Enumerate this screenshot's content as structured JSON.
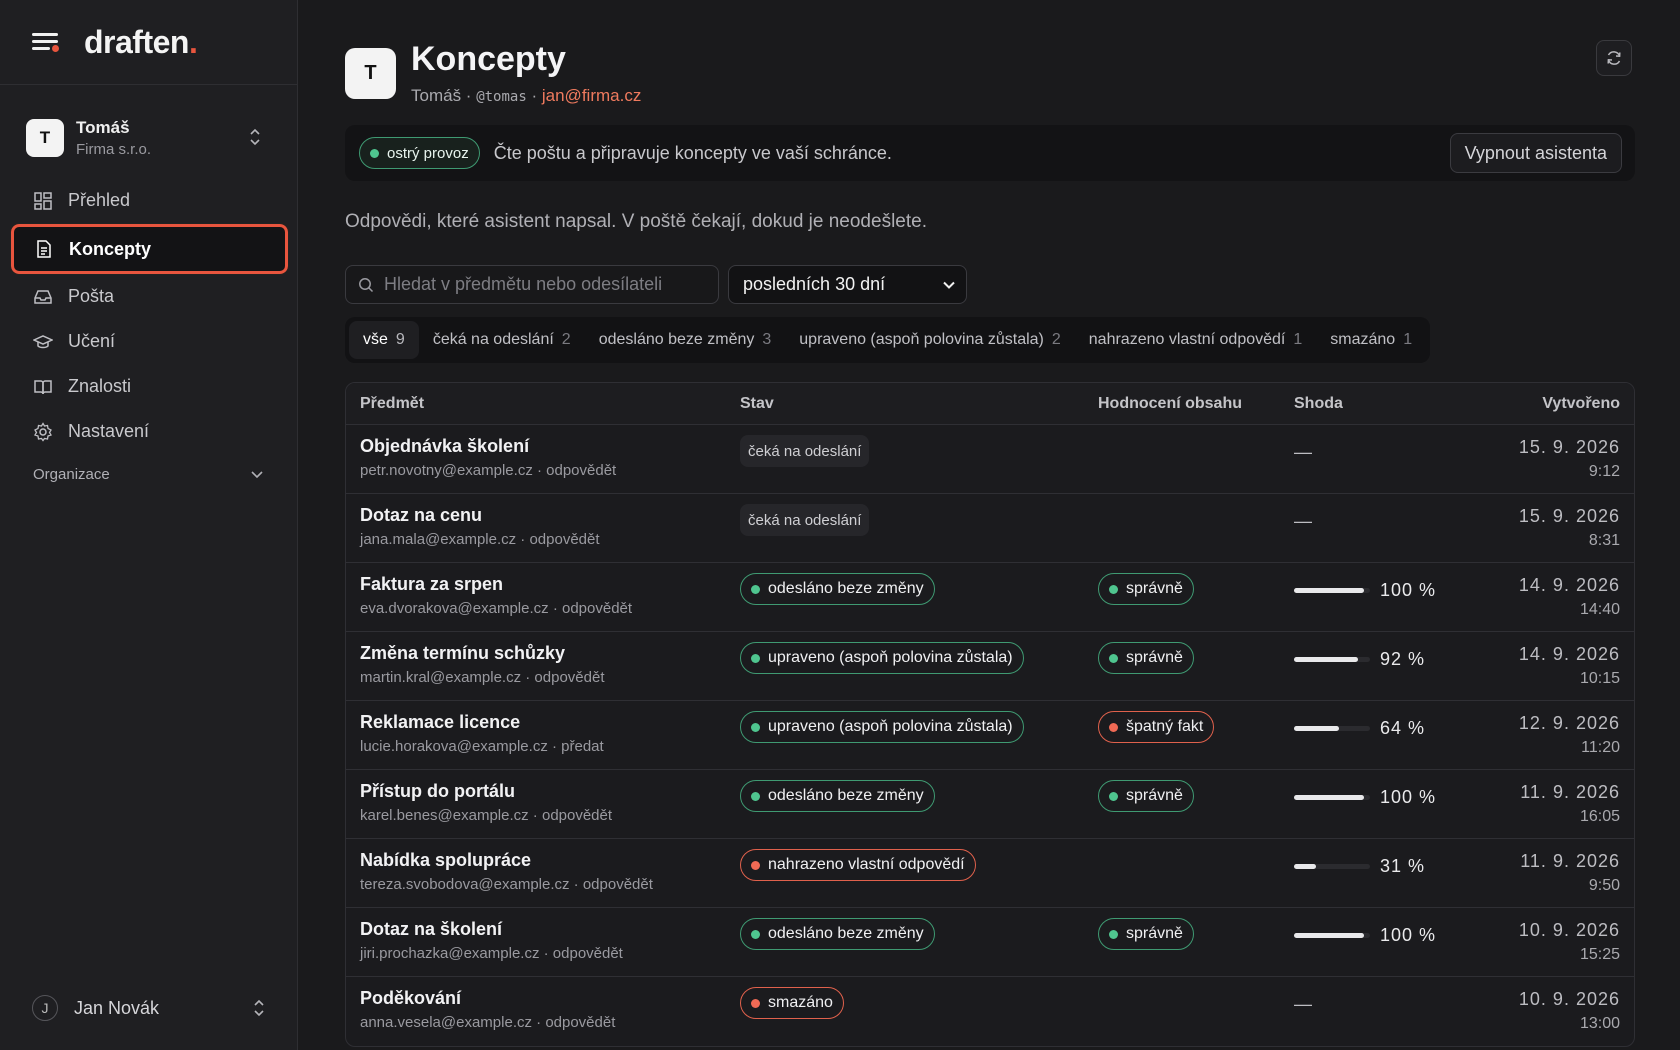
{
  "brand": {
    "name": "draften",
    "dot": "."
  },
  "account": {
    "initial": "T",
    "name": "Tomáš",
    "org": "Firma s.r.o."
  },
  "nav": [
    {
      "label": "Přehled",
      "icon": "dashboard-icon"
    },
    {
      "label": "Koncepty",
      "icon": "document-icon",
      "active": true
    },
    {
      "label": "Pošta",
      "icon": "inbox-icon"
    },
    {
      "label": "Učení",
      "icon": "graduation-cap-icon"
    },
    {
      "label": "Znalosti",
      "icon": "book-icon"
    },
    {
      "label": "Nastavení",
      "icon": "gear-icon"
    }
  ],
  "org_section": "Organizace",
  "user": {
    "initial": "J",
    "name": "Jan Novák"
  },
  "header": {
    "initial": "T",
    "title": "Koncepty",
    "sub_name": "Tomáš",
    "sub_sep": " · ",
    "handle": "@tomas",
    "email": "jan@firma.cz"
  },
  "status": {
    "pill": "ostrý provoz",
    "text": "Čte poštu a připravuje koncepty ve vaší schránce.",
    "button": "Vypnout asistenta"
  },
  "lead": "Odpovědi, které asistent napsal. V poště čekají, dokud je neodešlete.",
  "search": {
    "placeholder": "Hledat v předmětu nebo odesílateli",
    "value": ""
  },
  "period": {
    "selected": "posledních 30 dní"
  },
  "filters": [
    {
      "label": "vše",
      "count": "9",
      "active": true
    },
    {
      "label": "čeká na odeslání",
      "count": "2"
    },
    {
      "label": "odesláno beze změny",
      "count": "3"
    },
    {
      "label": "upraveno (aspoň polovina zůstala)",
      "count": "2"
    },
    {
      "label": "nahrazeno vlastní odpovědí",
      "count": "1"
    },
    {
      "label": "smazáno",
      "count": "1"
    }
  ],
  "table": {
    "headers": {
      "subject": "Předmět",
      "status": "Stav",
      "eval": "Hodnocení obsahu",
      "match": "Shoda",
      "created": "Vytvořeno"
    },
    "rows": [
      {
        "subject": "Objednávka školení",
        "meta": "petr.novotny@example.cz · odpovědět",
        "status": "čeká na odeslání",
        "status_kind": "plain",
        "eval": "",
        "eval_kind": "",
        "match": null,
        "date": "15. 9. 2026",
        "time": "9:12"
      },
      {
        "subject": "Dotaz na cenu",
        "meta": "jana.mala@example.cz · odpovědět",
        "status": "čeká na odeslání",
        "status_kind": "plain",
        "eval": "",
        "eval_kind": "",
        "match": null,
        "date": "15. 9. 2026",
        "time": "8:31"
      },
      {
        "subject": "Faktura za srpen",
        "meta": "eva.dvorakova@example.cz · odpovědět",
        "status": "odesláno beze změny",
        "status_kind": "green",
        "eval": "správně",
        "eval_kind": "green",
        "match": 100,
        "date": "14. 9. 2026",
        "time": "14:40"
      },
      {
        "subject": "Změna termínu schůzky",
        "meta": "martin.kral@example.cz · odpovědět",
        "status": "upraveno (aspoň polovina zůstala)",
        "status_kind": "green",
        "eval": "správně",
        "eval_kind": "green",
        "match": 92,
        "date": "14. 9. 2026",
        "time": "10:15"
      },
      {
        "subject": "Reklamace licence",
        "meta": "lucie.horakova@example.cz · předat",
        "status": "upraveno (aspoň polovina zůstala)",
        "status_kind": "green",
        "eval": "špatný fakt",
        "eval_kind": "red",
        "match": 64,
        "date": "12. 9. 2026",
        "time": "11:20"
      },
      {
        "subject": "Přístup do portálu",
        "meta": "karel.benes@example.cz · odpovědět",
        "status": "odesláno beze změny",
        "status_kind": "green",
        "eval": "správně",
        "eval_kind": "green",
        "match": 100,
        "date": "11. 9. 2026",
        "time": "16:05"
      },
      {
        "subject": "Nabídka spolupráce",
        "meta": "tereza.svobodova@example.cz · odpovědět",
        "status": "nahrazeno vlastní odpovědí",
        "status_kind": "red",
        "eval": "",
        "eval_kind": "",
        "match": 31,
        "date": "11. 9. 2026",
        "time": "9:50"
      },
      {
        "subject": "Dotaz na školení",
        "meta": "jiri.prochazka@example.cz · odpovědět",
        "status": "odesláno beze změny",
        "status_kind": "green",
        "eval": "správně",
        "eval_kind": "green",
        "match": 100,
        "date": "10. 9. 2026",
        "time": "15:25"
      },
      {
        "subject": "Poděkování",
        "meta": "anna.vesela@example.cz · odpovědět",
        "status": "smazáno",
        "status_kind": "red",
        "eval": "",
        "eval_kind": "",
        "match": null,
        "date": "10. 9. 2026",
        "time": "13:00"
      }
    ],
    "empty_match": "—",
    "pct_suffix": " %"
  }
}
